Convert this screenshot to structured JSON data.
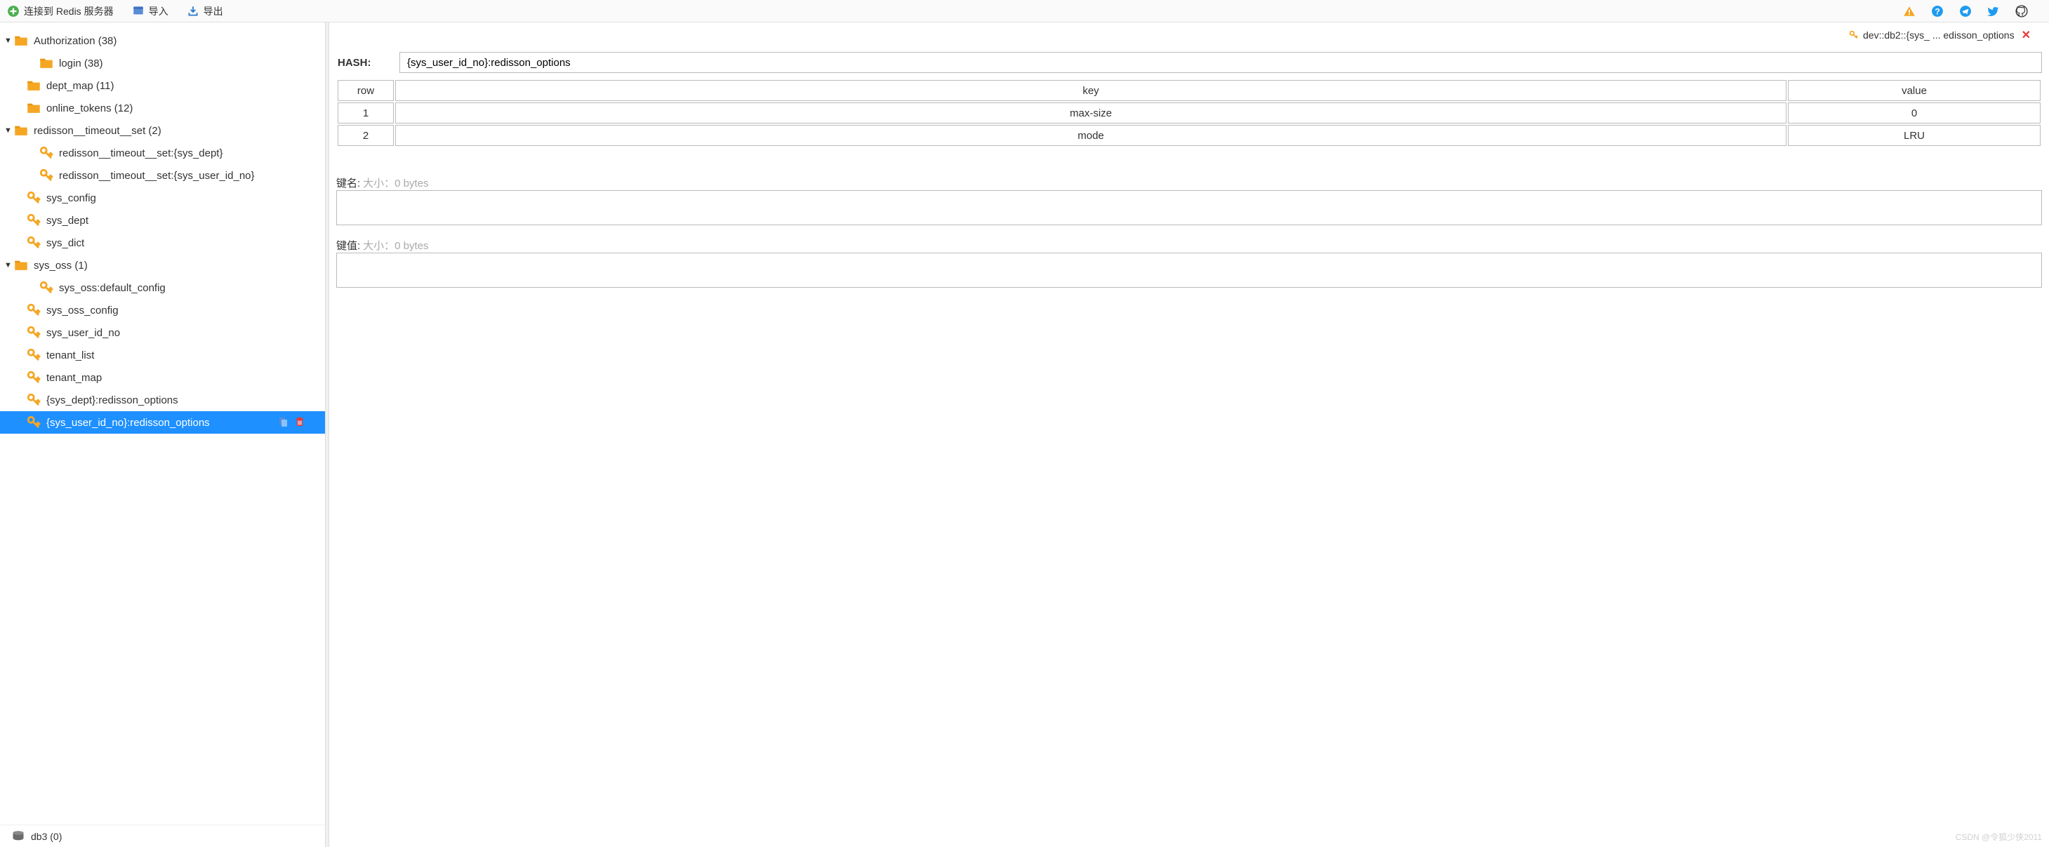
{
  "toolbar": {
    "connect_label": "连接到 Redis 服务器",
    "import_label": "导入",
    "export_label": "导出"
  },
  "tree": [
    {
      "type": "folder",
      "arrow": "▼",
      "indent": 0,
      "label": "Authorization (38)"
    },
    {
      "type": "folder",
      "arrow": "",
      "indent": 2,
      "label": "login (38)"
    },
    {
      "type": "folder",
      "arrow": "",
      "indent": 1,
      "label": "dept_map (11)"
    },
    {
      "type": "folder",
      "arrow": "",
      "indent": 1,
      "label": "online_tokens (12)"
    },
    {
      "type": "folder",
      "arrow": "▼",
      "indent": 0,
      "label": "redisson__timeout__set (2)"
    },
    {
      "type": "key",
      "arrow": "",
      "indent": 2,
      "label": "redisson__timeout__set:{sys_dept}"
    },
    {
      "type": "key",
      "arrow": "",
      "indent": 2,
      "label": "redisson__timeout__set:{sys_user_id_no}"
    },
    {
      "type": "key",
      "arrow": "",
      "indent": 1,
      "label": "sys_config"
    },
    {
      "type": "key",
      "arrow": "",
      "indent": 1,
      "label": "sys_dept"
    },
    {
      "type": "key",
      "arrow": "",
      "indent": 1,
      "label": "sys_dict"
    },
    {
      "type": "folder",
      "arrow": "▼",
      "indent": 0,
      "label": "sys_oss (1)"
    },
    {
      "type": "key",
      "arrow": "",
      "indent": 2,
      "label": "sys_oss:default_config"
    },
    {
      "type": "key",
      "arrow": "",
      "indent": 1,
      "label": "sys_oss_config"
    },
    {
      "type": "key",
      "arrow": "",
      "indent": 1,
      "label": "sys_user_id_no"
    },
    {
      "type": "key",
      "arrow": "",
      "indent": 1,
      "label": "tenant_list"
    },
    {
      "type": "key",
      "arrow": "",
      "indent": 1,
      "label": "tenant_map"
    },
    {
      "type": "key",
      "arrow": "",
      "indent": 1,
      "label": "{sys_dept}:redisson_options"
    },
    {
      "type": "key",
      "arrow": "",
      "indent": 1,
      "label": "{sys_user_id_no}:redisson_options",
      "selected": true
    }
  ],
  "db": {
    "label": "db3  (0)"
  },
  "tab": {
    "label": "dev::db2::{sys_ ... edisson_options"
  },
  "hash": {
    "label": "HASH:",
    "value": "{sys_user_id_no}:redisson_options"
  },
  "table": {
    "headers": {
      "row": "row",
      "key": "key",
      "value": "value"
    },
    "rows": [
      {
        "row": "1",
        "key": "max-size",
        "value": "0"
      },
      {
        "row": "2",
        "key": "mode",
        "value": "LRU"
      }
    ]
  },
  "detail": {
    "keyname_label": "键名:",
    "keyname_hint": "大小：0 bytes",
    "keyval_label": "键值:",
    "keyval_hint": "大小：0 bytes"
  },
  "watermark": "CSDN @令狐少侠2011"
}
